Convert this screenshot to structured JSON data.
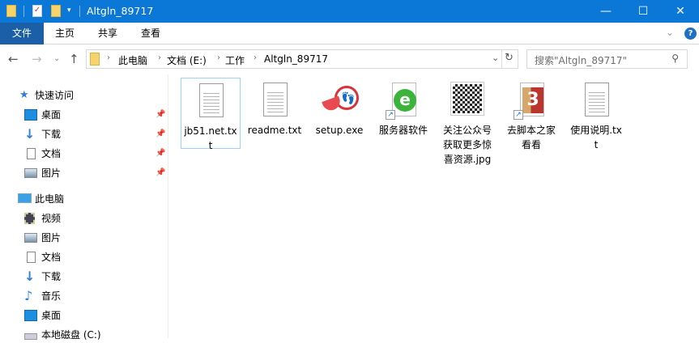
{
  "window": {
    "title": "Altgln_89717",
    "minimize": "—",
    "maximize": "☐",
    "close": "✕"
  },
  "ribbon": {
    "tabs": [
      "文件",
      "主页",
      "共享",
      "查看"
    ],
    "help": "?",
    "expand": "⌄"
  },
  "address": {
    "back": "←",
    "forward": "→",
    "recent": "⌄",
    "up": "↑",
    "crumbs": [
      "此电脑",
      "文档 (E:)",
      "工作",
      "Altgln_89717"
    ],
    "refresh": "↻",
    "dropdown": "⌄"
  },
  "search": {
    "placeholder": "搜索\"Altgln_89717\"",
    "icon": "⚲"
  },
  "sidebar": {
    "quick_access": "快速访问",
    "quick_items": [
      "桌面",
      "下载",
      "文档",
      "图片"
    ],
    "this_pc": "此电脑",
    "pc_items": [
      "视频",
      "图片",
      "文档",
      "下载",
      "音乐",
      "桌面",
      "本地磁盘 (C:)"
    ]
  },
  "files": [
    {
      "name": "jb51.net.txt",
      "type": "txt"
    },
    {
      "name": "readme.txt",
      "type": "txt"
    },
    {
      "name": "setup.exe",
      "type": "exe"
    },
    {
      "name": "服务器软件",
      "type": "shortcut-ie"
    },
    {
      "name": "关注公众号获取更多惊喜资源.jpg",
      "type": "jpg"
    },
    {
      "name": "去脚本之家看看",
      "type": "shortcut-jb"
    },
    {
      "name": "使用说明.txt",
      "type": "txt"
    }
  ],
  "colors": {
    "titlebar": "#0b78d7",
    "file_tab": "#1a5fa8",
    "selection": "#99d1ff"
  }
}
